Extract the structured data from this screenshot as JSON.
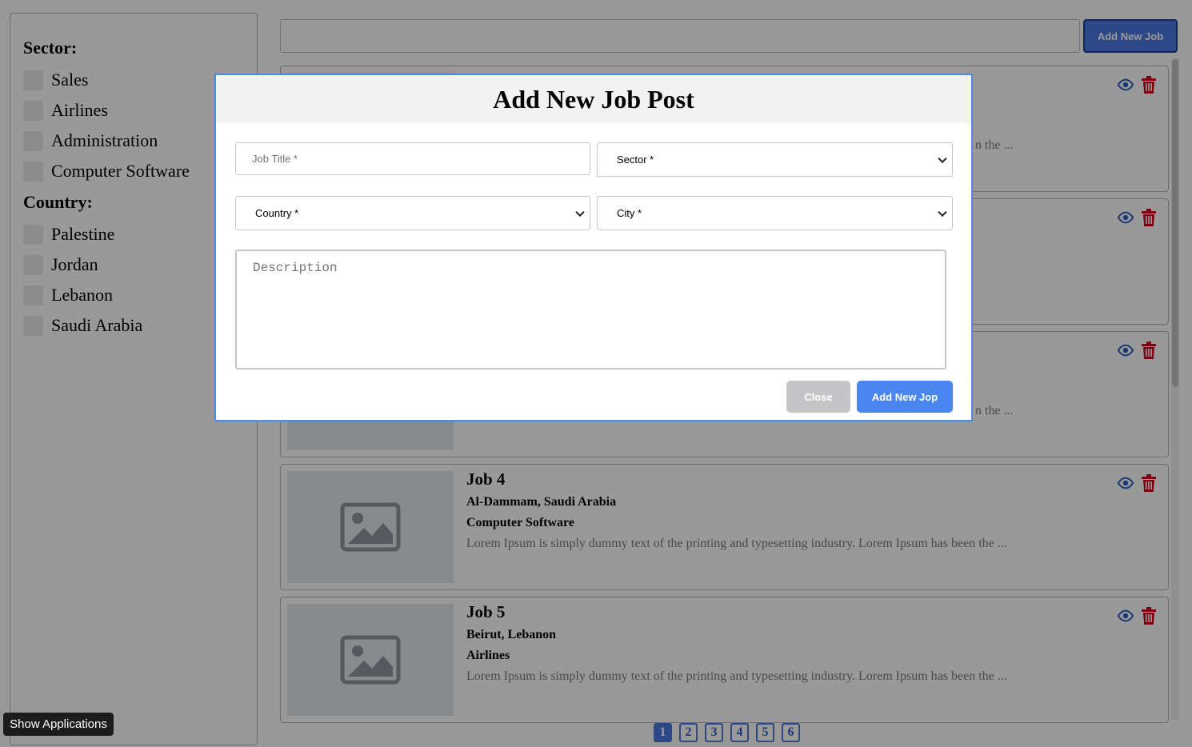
{
  "sidebar": {
    "sector_heading": "Sector:",
    "sectors": [
      "Sales",
      "Airlines",
      "Administration",
      "Computer Software"
    ],
    "country_heading": "Country:",
    "countries": [
      "Palestine",
      "Jordan",
      "Lebanon",
      "Saudi Arabia"
    ]
  },
  "header": {
    "search_value": "",
    "add_job_label": "Add New Job"
  },
  "jobs": [
    {
      "title": "",
      "location": "",
      "sector": "",
      "desc": "n the ..."
    },
    {
      "title": "",
      "location": "",
      "sector": "",
      "desc": ""
    },
    {
      "title": "",
      "location": "",
      "sector": "",
      "desc": "n the ..."
    },
    {
      "title": "Job 4",
      "location": "Al-Dammam, Saudi Arabia",
      "sector": "Computer Software",
      "desc": "Lorem Ipsum is simply dummy text of the printing and typesetting industry. Lorem Ipsum has been the ..."
    },
    {
      "title": "Job 5",
      "location": "Beirut, Lebanon",
      "sector": "Airlines",
      "desc": "Lorem Ipsum is simply dummy text of the printing and typesetting industry. Lorem Ipsum has been the ..."
    }
  ],
  "pagination": {
    "pages": [
      "1",
      "2",
      "3",
      "4",
      "5",
      "6"
    ],
    "current": "1"
  },
  "show_applications_label": "Show Applications",
  "modal": {
    "title": "Add New Job Post",
    "job_title_placeholder": "Job Title *",
    "sector_value": "Sector *",
    "country_value": "Country *",
    "city_value": "City *",
    "description_placeholder": "Description",
    "close_label": "Close",
    "submit_label": "Add New Jop"
  },
  "colors": {
    "accent": "#4a79e2",
    "delete": "#d0021b",
    "overlay": "rgba(0,0,0,0.4)"
  },
  "icons": {
    "view": "eye-icon",
    "delete": "trash-icon",
    "placeholder": "image-placeholder-icon"
  }
}
